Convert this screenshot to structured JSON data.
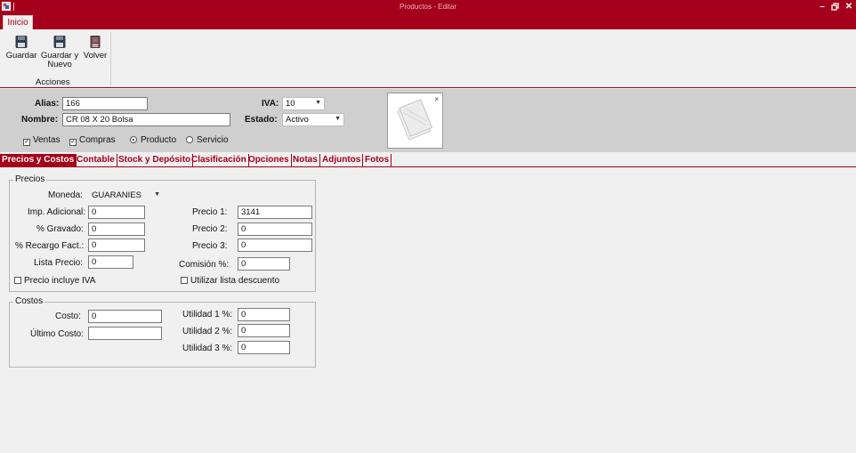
{
  "window": {
    "title": "Productos - Editar"
  },
  "ribbon": {
    "tab": "Inicio",
    "group_label": "Acciones",
    "buttons": {
      "guardar": "Guardar",
      "guardar_nuevo_1": "Guardar y",
      "guardar_nuevo_2": "Nuevo",
      "volver": "Volver"
    }
  },
  "header": {
    "alias_label": "Alias:",
    "alias_value": "166",
    "nombre_label": "Nombre:",
    "nombre_value": "CR 08 X 20 Bolsa",
    "iva_label": "IVA:",
    "iva_value": "10",
    "estado_label": "Estado:",
    "estado_value": "Activo",
    "ventas": "Ventas",
    "compras": "Compras",
    "producto": "Producto",
    "servicio": "Servicio",
    "photo_close": "×"
  },
  "tabs": [
    "Precios y Costos",
    "Contable",
    "Stock y Depósito",
    "Clasificación",
    "Opciones",
    "Notas",
    "Adjuntos",
    "Fotos"
  ],
  "precios": {
    "legend": "Precios",
    "moneda_label": "Moneda:",
    "moneda_value": "GUARANIES",
    "imp_adicional_label": "Imp. Adicional:",
    "imp_adicional": "0",
    "gravado_label": "% Gravado:",
    "gravado": "0",
    "recargo_label": "% Recargo Fact.:",
    "recargo": "0",
    "lista_precio_label": "Lista Precio:",
    "lista_precio": "0",
    "precio1_label": "Precio 1:",
    "precio1": "3141",
    "precio2_label": "Precio 2:",
    "precio2": "0",
    "precio3_label": "Precio 3:",
    "precio3": "0",
    "comision_label": "Comisión %:",
    "comision": "0",
    "incluye_iva": "Precio incluye IVA",
    "utilizar_lista": "Utilizar lista descuento"
  },
  "costos": {
    "legend": "Costos",
    "costo_label": "Costo:",
    "costo": "0",
    "ultimo_costo_label": "Último Costo:",
    "ultimo_costo": "",
    "utilidad1_label": "Utilidad 1 %:",
    "utilidad1": "0",
    "utilidad2_label": "Utilidad 2 %:",
    "utilidad2": "0",
    "utilidad3_label": "Utilidad 3 %:",
    "utilidad3": "0"
  },
  "colors": {
    "accent": "#a5001b",
    "background": "#f0f0f0",
    "header_panel": "#cfcfcf"
  }
}
